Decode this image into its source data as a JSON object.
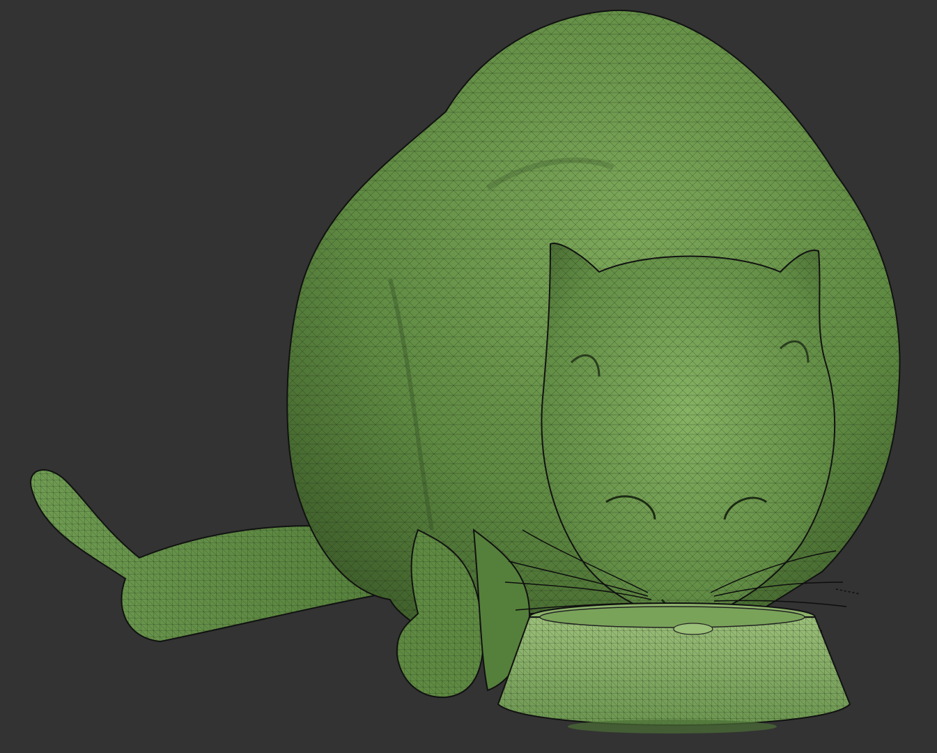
{
  "scene": {
    "subject": "cat-eating-from-bowl-wireframe",
    "render_mode": "wireframe-shaded",
    "colors": {
      "background": "#333333",
      "mesh_fill": "#6e9a4e",
      "mesh_fill_light": "#8fb56a",
      "mesh_fill_dark": "#3f5f2c",
      "wire_lines": "#1a2514",
      "whiskers": "#0d0d0d"
    }
  }
}
